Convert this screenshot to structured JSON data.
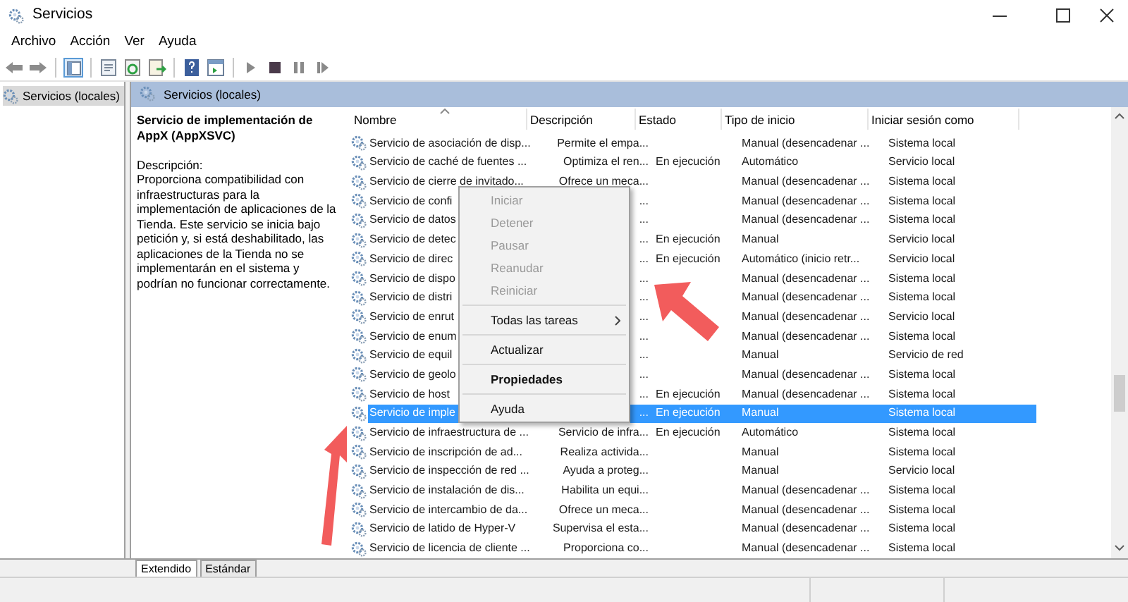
{
  "window": {
    "title": "Servicios"
  },
  "menu_bar": [
    "Archivo",
    "Acción",
    "Ver",
    "Ayuda"
  ],
  "toolbar": [
    {
      "kind": "back"
    },
    {
      "kind": "forward"
    },
    {
      "kind": "separator"
    },
    {
      "kind": "tree"
    },
    {
      "kind": "separator"
    },
    {
      "kind": "properties"
    },
    {
      "kind": "refresh"
    },
    {
      "kind": "export"
    },
    {
      "kind": "separator"
    },
    {
      "kind": "help"
    },
    {
      "kind": "pane"
    },
    {
      "kind": "separator"
    },
    {
      "kind": "play"
    },
    {
      "kind": "stop"
    },
    {
      "kind": "pause"
    },
    {
      "kind": "resume"
    }
  ],
  "tree": [
    {
      "label": "Servicios (locales)",
      "selected": true
    }
  ],
  "panel": {
    "title": "Servicios (locales)"
  },
  "details": {
    "service_title": "Servicio de implementación de AppX (AppXSVC)",
    "description_label": "Descripción:",
    "description": "Proporciona compatibilidad con infraestructuras para la implementación de aplicaciones de la Tienda. Este servicio se inicia bajo petición y, si está deshabilitado, las aplicaciones de la Tienda no se implementarán en el sistema y podrían no funcionar correctamente."
  },
  "table": {
    "columns": [
      "Nombre",
      "Descripción",
      "Estado",
      "Tipo de inicio",
      "Iniciar sesión como"
    ],
    "rows": [
      {
        "name": "Servicio de asociación de disp...",
        "description": "Permite el empa...",
        "status": "",
        "startup": "Manual (desencadenar ...",
        "logon": "Sistema local",
        "selected": false
      },
      {
        "name": "Servicio de caché de fuentes ...",
        "description": "Optimiza el ren...",
        "status": "En ejecución",
        "startup": "Automático",
        "logon": "Servicio local",
        "selected": false
      },
      {
        "name": "Servicio de cierre de invitado...",
        "description": "Ofrece un meca...",
        "status": "",
        "startup": "Manual (desencadenar ...",
        "logon": "Sistema local",
        "selected": false
      },
      {
        "name": "Servicio de confi",
        "description": "...",
        "status": "",
        "startup": "Manual (desencadenar ...",
        "logon": "Sistema local",
        "selected": false
      },
      {
        "name": "Servicio de datos",
        "description": "...",
        "status": "",
        "startup": "Manual (desencadenar ...",
        "logon": "Sistema local",
        "selected": false
      },
      {
        "name": "Servicio de detec",
        "description": "...",
        "status": "En ejecución",
        "startup": "Manual",
        "logon": "Servicio local",
        "selected": false
      },
      {
        "name": "Servicio de direc",
        "description": "...",
        "status": "En ejecución",
        "startup": "Automático (inicio retr...",
        "logon": "Servicio local",
        "selected": false
      },
      {
        "name": "Servicio de dispo",
        "description": "...",
        "status": "",
        "startup": "Manual (desencadenar ...",
        "logon": "Sistema local",
        "selected": false
      },
      {
        "name": "Servicio de distri",
        "description": "...",
        "status": "",
        "startup": "Manual (desencadenar ...",
        "logon": "Sistema local",
        "selected": false
      },
      {
        "name": "Servicio de enrut",
        "description": "...",
        "status": "",
        "startup": "Manual (desencadenar ...",
        "logon": "Servicio local",
        "selected": false
      },
      {
        "name": "Servicio de enum",
        "description": "...",
        "status": "",
        "startup": "Manual (desencadenar ...",
        "logon": "Sistema local",
        "selected": false
      },
      {
        "name": "Servicio de equil",
        "description": "...",
        "status": "",
        "startup": "Manual",
        "logon": "Servicio de red",
        "selected": false
      },
      {
        "name": "Servicio de geolo",
        "description": "...",
        "status": "",
        "startup": "Manual (desencadenar ...",
        "logon": "Sistema local",
        "selected": false
      },
      {
        "name": "Servicio de host",
        "description": "...",
        "status": "En ejecución",
        "startup": "Manual (desencadenar ...",
        "logon": "Sistema local",
        "selected": false
      },
      {
        "name": "Servicio de imple",
        "description": "...",
        "status": "En ejecución",
        "startup": "Manual",
        "logon": "Sistema local",
        "selected": true
      },
      {
        "name": "Servicio de infraestructura de ...",
        "description": "Servicio de infra...",
        "status": "En ejecución",
        "startup": "Automático",
        "logon": "Sistema local",
        "selected": false
      },
      {
        "name": "Servicio de inscripción de ad...",
        "description": "Realiza activida...",
        "status": "",
        "startup": "Manual",
        "logon": "Sistema local",
        "selected": false
      },
      {
        "name": "Servicio de inspección de red ...",
        "description": "Ayuda a proteg...",
        "status": "",
        "startup": "Manual",
        "logon": "Servicio local",
        "selected": false
      },
      {
        "name": "Servicio de instalación de dis...",
        "description": "Habilita un equi...",
        "status": "",
        "startup": "Manual (desencadenar ...",
        "logon": "Sistema local",
        "selected": false
      },
      {
        "name": "Servicio de intercambio de da...",
        "description": "Ofrece un meca...",
        "status": "",
        "startup": "Manual (desencadenar ...",
        "logon": "Sistema local",
        "selected": false
      },
      {
        "name": "Servicio de latido de Hyper-V",
        "description": "Supervisa el esta...",
        "status": "",
        "startup": "Manual (desencadenar ...",
        "logon": "Sistema local",
        "selected": false
      },
      {
        "name": "Servicio de licencia de cliente ...",
        "description": "Proporciona co...",
        "status": "",
        "startup": "Manual (desencadenar ...",
        "logon": "Sistema local",
        "selected": false
      }
    ]
  },
  "context_menu": [
    {
      "kind": "item",
      "label": "Iniciar",
      "disabled": true,
      "bold": false,
      "submenu": false
    },
    {
      "kind": "item",
      "label": "Detener",
      "disabled": true,
      "bold": false,
      "submenu": false
    },
    {
      "kind": "item",
      "label": "Pausar",
      "disabled": true,
      "bold": false,
      "submenu": false
    },
    {
      "kind": "item",
      "label": "Reanudar",
      "disabled": true,
      "bold": false,
      "submenu": false
    },
    {
      "kind": "item",
      "label": "Reiniciar",
      "disabled": true,
      "bold": false,
      "submenu": false
    },
    {
      "kind": "separator"
    },
    {
      "kind": "item",
      "label": "Todas las tareas",
      "disabled": false,
      "bold": false,
      "submenu": true
    },
    {
      "kind": "separator"
    },
    {
      "kind": "item",
      "label": "Actualizar",
      "disabled": false,
      "bold": false,
      "submenu": false
    },
    {
      "kind": "separator"
    },
    {
      "kind": "item",
      "label": "Propiedades",
      "disabled": false,
      "bold": true,
      "submenu": false
    },
    {
      "kind": "separator"
    },
    {
      "kind": "item",
      "label": "Ayuda",
      "disabled": false,
      "bold": false,
      "submenu": false
    }
  ],
  "view_tabs": [
    {
      "label": "Extendido",
      "selected": true
    },
    {
      "label": "Estándar",
      "selected": false
    }
  ]
}
